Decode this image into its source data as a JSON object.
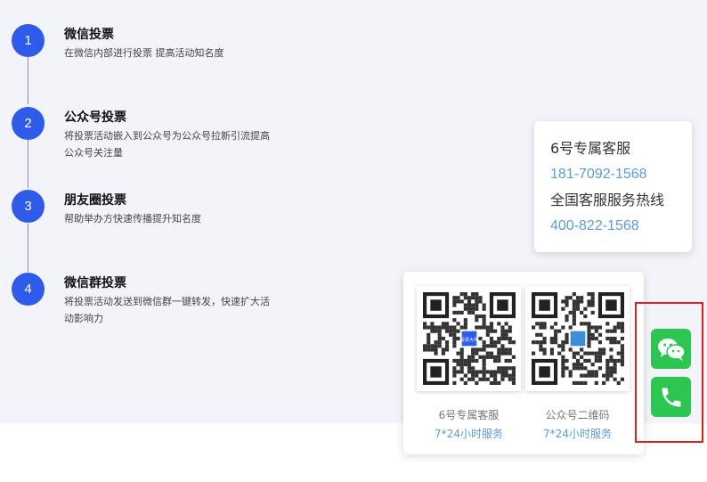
{
  "steps": [
    {
      "number": "1",
      "title": "微信投票",
      "desc": "在微信内部进行投票 提高活动知名度"
    },
    {
      "number": "2",
      "title": "公众号投票",
      "desc": "将投票活动嵌入到公众号为公众号拉新引流提高公众号关注量"
    },
    {
      "number": "3",
      "title": "朋友圈投票",
      "desc": "帮助举办方快速传播提升知名度"
    },
    {
      "number": "4",
      "title": "微信群投票",
      "desc": "将投票活动发送到微信群一键转发，快速扩大活动影响力"
    }
  ],
  "hotline": {
    "agent_label": "6号专属客服",
    "agent_phone": "181-7092-1568",
    "hotline_label": "全国客服服务热线",
    "hotline_phone": "400-822-1568"
  },
  "qr_codes": [
    {
      "caption": "6号专属客服",
      "hours": "7*24小时服务",
      "center_text": "投票大师"
    },
    {
      "caption": "公众号二维码",
      "hours": "7*24小时服务",
      "center_text": ""
    }
  ],
  "side_buttons": [
    {
      "icon": "wechat-icon"
    },
    {
      "icon": "phone-icon"
    }
  ],
  "colors": {
    "accent": "#2f5bea",
    "link": "#5b9bdc",
    "green": "#2dc653",
    "highlight_frame": "#e02020"
  }
}
